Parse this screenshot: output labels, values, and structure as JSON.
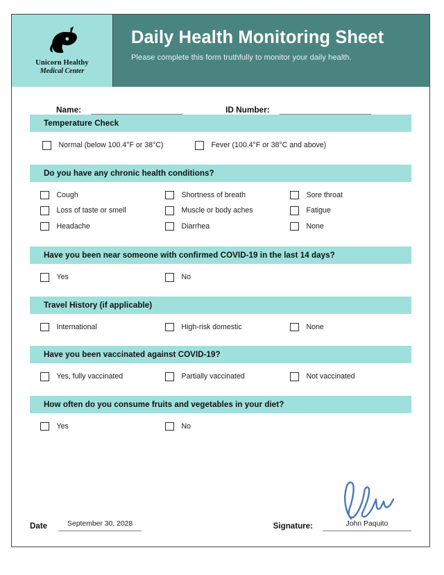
{
  "header": {
    "logo_icon": "unicorn-head-icon",
    "brand_line1": "Unicorn Healthy",
    "brand_line2": "Medical Center",
    "title": "Daily Health Monitoring Sheet",
    "subtitle": "Please complete this form truthfully to monitor your daily health.",
    "band_color": "#9fe0dc",
    "title_bg_color": "#4a8480"
  },
  "identity": {
    "name_label": "Name:",
    "name_value": "",
    "id_label": "ID Number:",
    "id_value": ""
  },
  "sections": [
    {
      "title": "Temperature Check",
      "layout": "wide2",
      "rows": [
        [
          "Normal (below 100.4°F or 38°C)",
          "Fever (100.4°F or 38°C and above)"
        ]
      ]
    },
    {
      "title": "Do you have any chronic health conditions?",
      "layout": "grid3",
      "rows": [
        [
          "Cough",
          "Shortness of breath",
          "Sore throat"
        ],
        [
          "Loss of taste or smell",
          "Muscle or body aches",
          "Fatigue"
        ],
        [
          "Headache",
          "Diarrhea",
          "None"
        ]
      ]
    },
    {
      "title": "Have you been near someone with confirmed COVID-19 in the last 14 days?",
      "layout": "grid3",
      "rows": [
        [
          "Yes",
          "No"
        ]
      ]
    },
    {
      "title": "Travel History (if applicable)",
      "layout": "grid3",
      "rows": [
        [
          "International",
          "High-risk domestic",
          "None"
        ]
      ]
    },
    {
      "title": "Have you been vaccinated against COVID-19?",
      "layout": "grid3",
      "rows": [
        [
          "Yes, fully vaccinated",
          "Partially vaccinated",
          "Not vaccinated"
        ]
      ]
    },
    {
      "title": "How often do you consume fruits and vegetables in your diet?",
      "layout": "grid3",
      "rows": [
        [
          "Yes",
          "No"
        ]
      ]
    }
  ],
  "footer": {
    "date_label": "Date",
    "date_value": "September 30, 2028",
    "signature_label": "Signature:",
    "signature_name": "John Paquito",
    "signature_ink_color": "#4a7ab5"
  }
}
